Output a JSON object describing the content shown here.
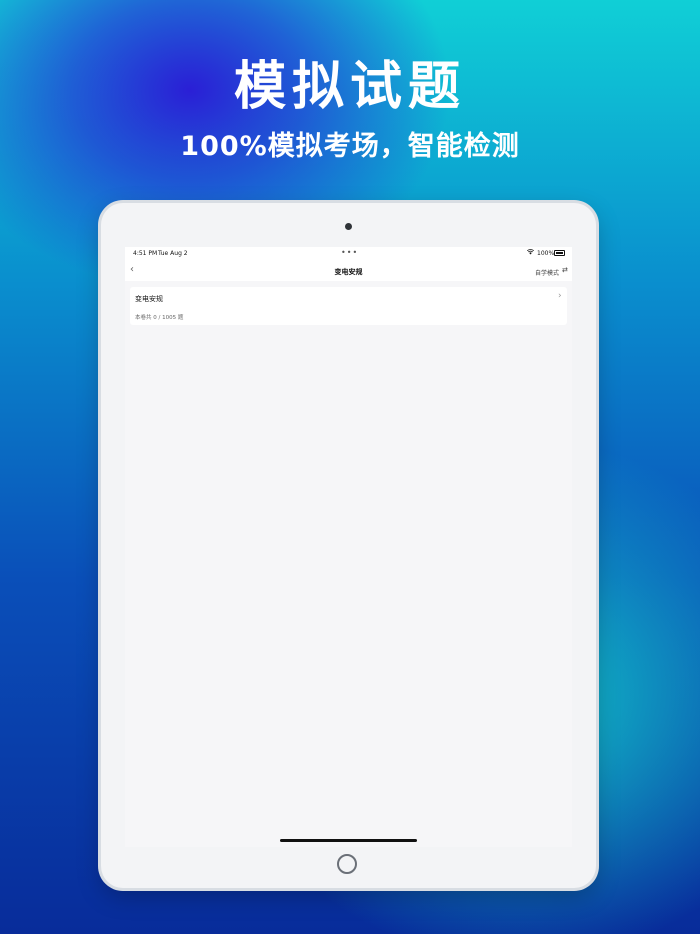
{
  "promo": {
    "headline": "模拟试题",
    "subline": "100%模拟考场，智能检测"
  },
  "status_bar": {
    "time": "4:51 PM",
    "date": "Tue Aug 2",
    "dots": "•••",
    "battery": "100%"
  },
  "nav": {
    "back_icon": "‹",
    "title": "变电安规",
    "mode_label": "自学模式",
    "mode_icon": "⇄"
  },
  "list": {
    "items": [
      {
        "name": "变电安规",
        "count_text": "本卷共 0 / 1005 题",
        "chevron": "›"
      }
    ]
  },
  "icons": {
    "wifi": "wifi-icon",
    "battery": "battery-icon",
    "back": "chevron-left-icon",
    "swap": "swap-icon",
    "chevron": "chevron-right-icon"
  }
}
